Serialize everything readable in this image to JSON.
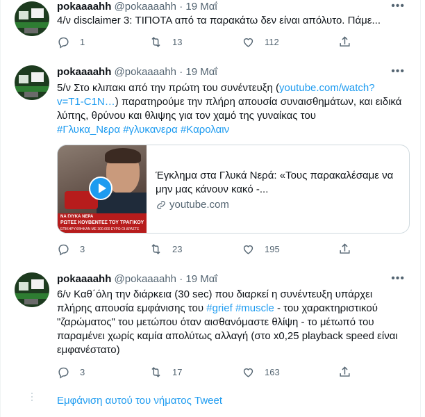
{
  "tweets": [
    {
      "name": "pokaaaahh",
      "handle": "@pokaaaahh",
      "date": "19 Μαΐ",
      "text": "4/ν disclaimer 3: ΤΙΠΟΤΑ από τα παρακάτω δεν είναι απόλυτο. Πάμε...",
      "replies": "1",
      "retweets": "13",
      "likes": "112"
    },
    {
      "name": "pokaaaahh",
      "handle": "@pokaaaahh",
      "date": "19 Μαΐ",
      "text_line1_a": "5/ν Στο κλιπακι από την πρώτη του συνέντευξη (",
      "link1": "youtube.com/watch?",
      "link2": "v=T1-C1N…",
      "text_line2_b": ") παρατηρούμε την πλήρη απουσία συναισθημάτων, και ειδικά",
      "text_line3": "λύπης, θρύνου και θλιψης για τον χαμό της γυναίκας του",
      "hashtags": [
        "#Γλυκα_Νερα",
        "#γλυκανερα",
        "#Καρολαιν"
      ],
      "card": {
        "title": "Έγκλημα στα Γλυκά Νερά: «Τους παρακαλέσαμε να μην μας κάνουν κακό -...",
        "domain": "youtube.com",
        "caption_top": "ΝΑ ΓΛΥΚΑ ΝΕΡΑ",
        "caption_main": "ΡΩΤΕΣ ΚΟΥΒΕΝΤΕΣ ΤΟΥ ΤΡΑΓΙΚΟΥ",
        "caption_bottom": "ΕΠΙΚΗΡΥΧΘΗΚΑΝ ΜΕ 300.000 ΕΥΡΩ ΟΙ ΔΡΑΣΤΕ"
      },
      "replies": "3",
      "retweets": "23",
      "likes": "195"
    },
    {
      "name": "pokaaaahh",
      "handle": "@pokaaaahh",
      "date": "19 Μαΐ",
      "line1": "6/ν Καθ΄όλη την διάρκεια (30 sec) που διαρκεί η συνέντευξη υπάρχει",
      "line2_a": "πλήρης απουσία εμφάνισης του ",
      "tag_grief": "#grief",
      "tag_muscle": "#muscle",
      "line2_b": " - του χαρακτηριστικού",
      "line3": "\"ζαρώματος\" του μετώπου όταν αισθανόμαστε θλίψη - το μέτωπό του",
      "line4": "παραμένει χωρίς καμία απολύτως αλλαγή (στο x0,25 playback speed είναι",
      "line5": "εμφανέστατο)",
      "replies": "3",
      "retweets": "17",
      "likes": "163"
    }
  ],
  "show_thread": "Εμφάνιση αυτού του νήματος Tweet",
  "dot_sep": "·",
  "more_glyph": "•••",
  "icons": {
    "reply": "reply-icon",
    "retweet": "retweet-icon",
    "like": "like-icon",
    "share": "share-icon",
    "link": "link-icon",
    "play": "play-icon"
  }
}
